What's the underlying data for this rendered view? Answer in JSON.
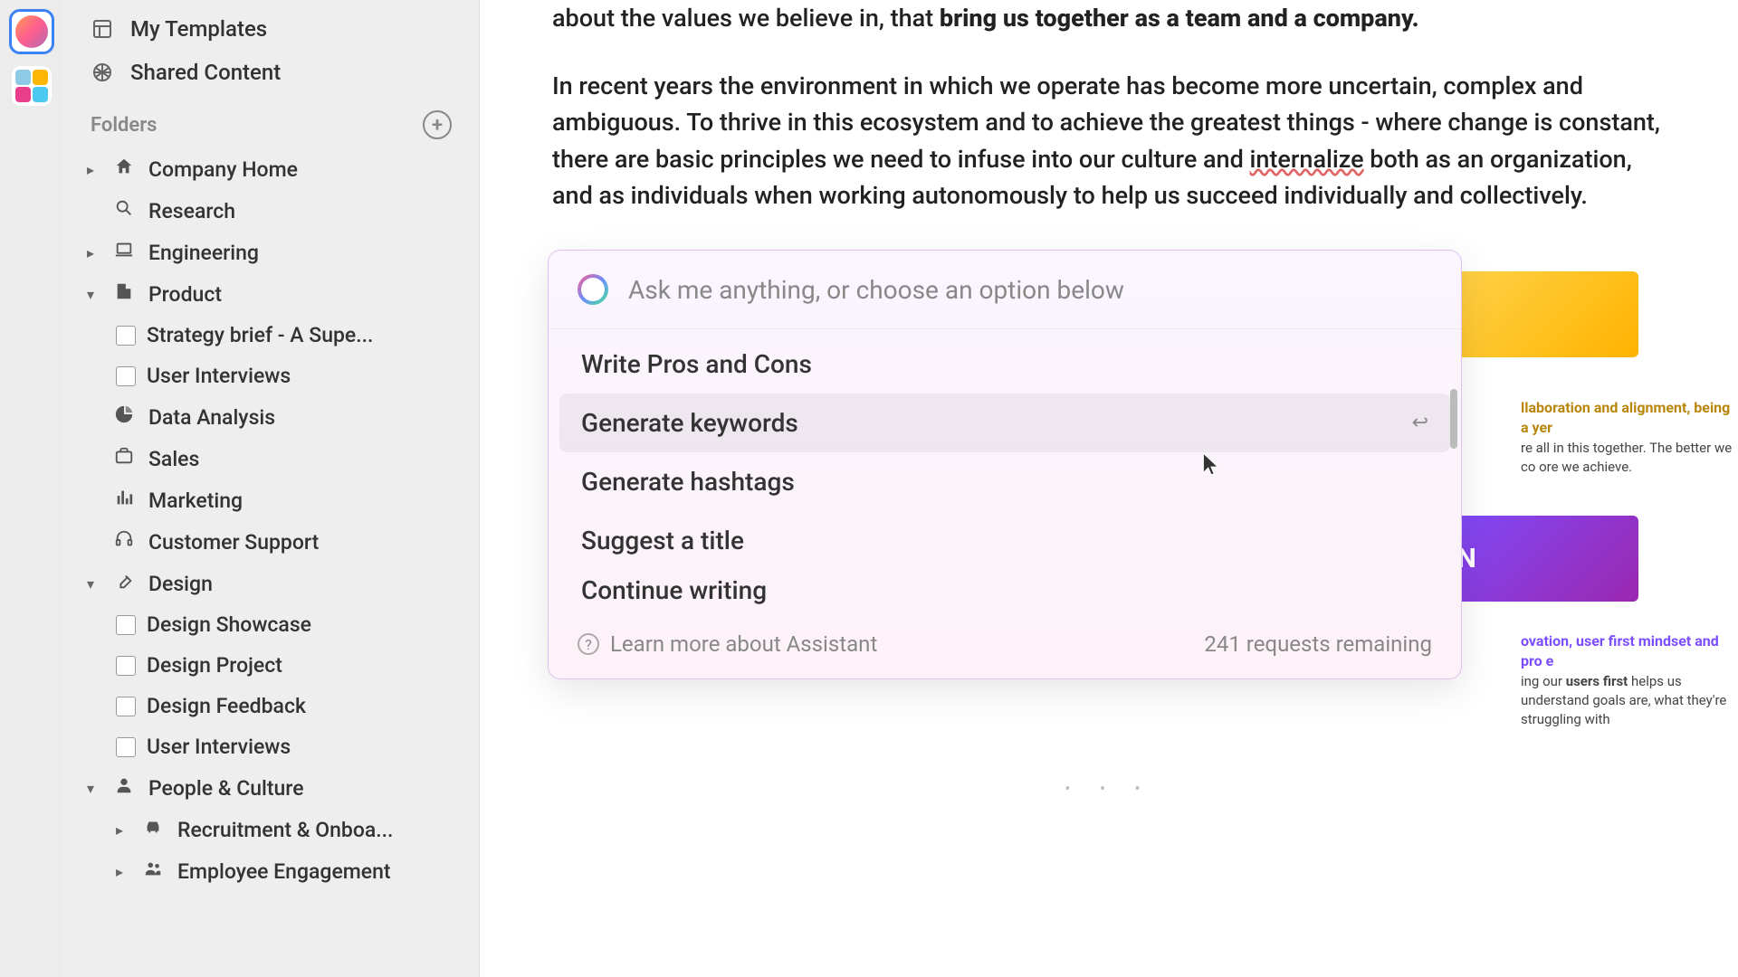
{
  "rail": {
    "miniColors": [
      "#8ecae6",
      "#ffb703",
      "#e83e8c",
      "#4cc9f0"
    ]
  },
  "sidebar": {
    "my_templates": "My Templates",
    "shared_content": "Shared Content",
    "folders_label": "Folders",
    "company_home": "Company Home",
    "research": "Research",
    "engineering": "Engineering",
    "product": "Product",
    "strategy_brief": "Strategy brief - A Supe...",
    "user_interviews": "User Interviews",
    "data_analysis": "Data Analysis",
    "sales": "Sales",
    "marketing": "Marketing",
    "customer_support": "Customer Support",
    "design": "Design",
    "design_showcase": "Design Showcase",
    "design_project": "Design Project",
    "design_feedback": "Design Feedback",
    "user_interviews_2": "User Interviews",
    "people_culture": "People & Culture",
    "recruitment": "Recruitment & Onboa...",
    "employee_engagement": "Employee Engagement"
  },
  "doc": {
    "line1a": "about the values we believe in, that ",
    "line1b": "bring us together as a team and a company.",
    "para2a": "In recent years the environment in which we operate has become more uncertain, complex and ambiguous. To thrive in this ecosystem and to achieve the greatest things - where change is constant, there are basic principles we need to infuse into our culture and ",
    "para2_err": "internalize",
    "para2b": " both as an organization, and as individuals when working autonomously to help us succeed individually and collectively."
  },
  "cards": {
    "purple_label": "ON",
    "yellow_head": "llaboration and alignment, being a yer",
    "yellow_body": "re all in this together. The better we co ore we achieve.",
    "blue_head": "ovation, user first mindset and pro e",
    "blue_body_a": "ing our ",
    "blue_body_bold": "users first",
    "blue_body_b": " helps us understand goals are, what they're struggling with"
  },
  "assistant": {
    "placeholder": "Ask me anything, or choose an option below",
    "options": [
      "Write Pros and Cons",
      "Generate keywords",
      "Generate hashtags",
      "Suggest a title",
      "Continue writing"
    ],
    "learn_more": "Learn more about Assistant",
    "remaining": "241 requests remaining"
  }
}
